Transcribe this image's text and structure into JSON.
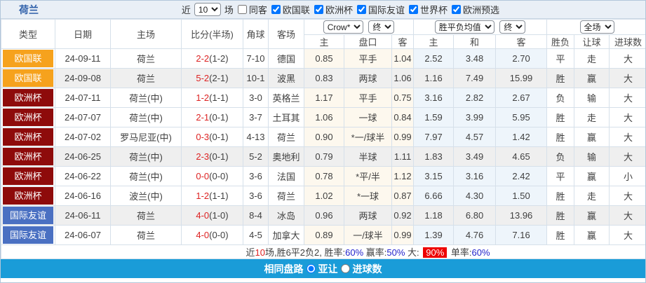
{
  "titlebar": {
    "title": "荷兰",
    "near_label": "近",
    "match_count": "10",
    "games_label": "场",
    "same_opponent": {
      "label": "同客",
      "checked": false
    },
    "leagues": [
      {
        "label": "欧国联",
        "checked": true
      },
      {
        "label": "欧洲杯",
        "checked": true
      },
      {
        "label": "国际友谊",
        "checked": true
      },
      {
        "label": "世界杯",
        "checked": true
      },
      {
        "label": "欧洲预选",
        "checked": true
      }
    ]
  },
  "controls": {
    "odds_source": "Crow*",
    "odds_time": "终",
    "avg_label": "胜平负均值",
    "avg_time": "终",
    "scope": "全场"
  },
  "table": {
    "header": {
      "main": [
        "类型",
        "日期",
        "主场",
        "比分(半场)",
        "角球",
        "客场"
      ],
      "sub": [
        "主",
        "盘口",
        "客",
        "主",
        "和",
        "客",
        "胜负",
        "让球",
        "进球数"
      ]
    },
    "rows": [
      {
        "league": {
          "label": "欧国联",
          "color": "orange"
        },
        "date": "24-09-11",
        "home": {
          "label": "荷兰",
          "green": true
        },
        "score_ft": "2-2",
        "score_ht": "(1-2)",
        "corners": "7-10",
        "away": {
          "label": "德国",
          "green": false
        },
        "crow": {
          "home": "0.85",
          "handicap": "平手",
          "handicap_color": "blue",
          "away": "1.04"
        },
        "avg": {
          "home": "2.52",
          "draw": "3.48",
          "away": "2.70"
        },
        "result": {
          "outcome": "平",
          "outcome_color": "blue",
          "handicap": "走",
          "handicap_color": "blue",
          "goals": "大",
          "goals_color": "red"
        },
        "shaded": false
      },
      {
        "league": {
          "label": "欧国联",
          "color": "orange"
        },
        "date": "24-09-08",
        "home": {
          "label": "荷兰",
          "green": true
        },
        "score_ft": "5-2",
        "score_ht": "(2-1)",
        "corners": "10-1",
        "away": {
          "label": "波黑",
          "green": false
        },
        "crow": {
          "home": "0.83",
          "handicap": "两球",
          "handicap_color": "blue",
          "away": "1.06"
        },
        "avg": {
          "home": "1.16",
          "draw": "7.49",
          "away": "15.99"
        },
        "result": {
          "outcome": "胜",
          "outcome_color": "red",
          "handicap": "赢",
          "handicap_color": "red",
          "goals": "大",
          "goals_color": "red"
        },
        "shaded": true
      },
      {
        "league": {
          "label": "欧洲杯",
          "color": "darkred"
        },
        "date": "24-07-11",
        "home": {
          "label": "荷兰(中)",
          "green": true
        },
        "score_ft": "1-2",
        "score_ht": "(1-1)",
        "corners": "3-0",
        "away": {
          "label": "英格兰",
          "green": false
        },
        "crow": {
          "home": "1.17",
          "handicap": "平手",
          "handicap_color": "blue",
          "away": "0.75"
        },
        "avg": {
          "home": "3.16",
          "draw": "2.82",
          "away": "2.67"
        },
        "result": {
          "outcome": "负",
          "outcome_color": "green",
          "handicap": "输",
          "handicap_color": "green",
          "goals": "大",
          "goals_color": "red"
        },
        "shaded": false
      },
      {
        "league": {
          "label": "欧洲杯",
          "color": "darkred"
        },
        "date": "24-07-07",
        "home": {
          "label": "荷兰(中)",
          "green": true
        },
        "score_ft": "2-1",
        "score_ht": "(0-1)",
        "corners": "3-7",
        "away": {
          "label": "土耳其",
          "green": false
        },
        "crow": {
          "home": "1.06",
          "handicap": "一球",
          "handicap_color": "blue",
          "away": "0.84"
        },
        "avg": {
          "home": "1.59",
          "draw": "3.99",
          "away": "5.95"
        },
        "result": {
          "outcome": "胜",
          "outcome_color": "red",
          "handicap": "走",
          "handicap_color": "blue",
          "goals": "大",
          "goals_color": "red"
        },
        "shaded": false
      },
      {
        "league": {
          "label": "欧洲杯",
          "color": "darkred"
        },
        "date": "24-07-02",
        "home": {
          "label": "罗马尼亚(中)",
          "green": false
        },
        "score_ft": "0-3",
        "score_ht": "(0-1)",
        "corners": "4-13",
        "away": {
          "label": "荷兰",
          "green": true
        },
        "crow": {
          "home": "0.90",
          "handicap": "*一/球半",
          "handicap_color": "red",
          "away": "0.99"
        },
        "avg": {
          "home": "7.97",
          "draw": "4.57",
          "away": "1.42"
        },
        "result": {
          "outcome": "胜",
          "outcome_color": "red",
          "handicap": "赢",
          "handicap_color": "red",
          "goals": "大",
          "goals_color": "red"
        },
        "shaded": false
      },
      {
        "league": {
          "label": "欧洲杯",
          "color": "darkred"
        },
        "date": "24-06-25",
        "home": {
          "label": "荷兰(中)",
          "green": true
        },
        "score_ft": "2-3",
        "score_ht": "(0-1)",
        "corners": "5-2",
        "away": {
          "label": "奥地利",
          "green": false
        },
        "crow": {
          "home": "0.79",
          "handicap": "半球",
          "handicap_color": "blue",
          "away": "1.11"
        },
        "avg": {
          "home": "1.83",
          "draw": "3.49",
          "away": "4.65"
        },
        "result": {
          "outcome": "负",
          "outcome_color": "green",
          "handicap": "输",
          "handicap_color": "green",
          "goals": "大",
          "goals_color": "red"
        },
        "shaded": true
      },
      {
        "league": {
          "label": "欧洲杯",
          "color": "darkred"
        },
        "date": "24-06-22",
        "home": {
          "label": "荷兰(中)",
          "green": true
        },
        "score_ft": "0-0",
        "score_ht": "(0-0)",
        "corners": "3-6",
        "away": {
          "label": "法国",
          "green": false
        },
        "crow": {
          "home": "0.78",
          "handicap": "*平/半",
          "handicap_color": "red",
          "away": "1.12"
        },
        "avg": {
          "home": "3.15",
          "draw": "3.16",
          "away": "2.42"
        },
        "result": {
          "outcome": "平",
          "outcome_color": "blue",
          "handicap": "赢",
          "handicap_color": "red",
          "goals": "小",
          "goals_color": "green"
        },
        "shaded": false
      },
      {
        "league": {
          "label": "欧洲杯",
          "color": "darkred"
        },
        "date": "24-06-16",
        "home": {
          "label": "波兰(中)",
          "green": false
        },
        "score_ft": "1-2",
        "score_ht": "(1-1)",
        "corners": "3-6",
        "away": {
          "label": "荷兰",
          "green": true
        },
        "crow": {
          "home": "1.02",
          "handicap": "*一球",
          "handicap_color": "red",
          "away": "0.87"
        },
        "avg": {
          "home": "6.66",
          "draw": "4.30",
          "away": "1.50"
        },
        "result": {
          "outcome": "胜",
          "outcome_color": "red",
          "handicap": "走",
          "handicap_color": "blue",
          "goals": "大",
          "goals_color": "red"
        },
        "shaded": false
      },
      {
        "league": {
          "label": "国际友谊",
          "color": "blue"
        },
        "date": "24-06-11",
        "home": {
          "label": "荷兰",
          "green": true
        },
        "score_ft": "4-0",
        "score_ht": "(1-0)",
        "corners": "8-4",
        "away": {
          "label": "冰岛",
          "green": false
        },
        "crow": {
          "home": "0.96",
          "handicap": "两球",
          "handicap_color": "blue",
          "away": "0.92"
        },
        "avg": {
          "home": "1.18",
          "draw": "6.80",
          "away": "13.96"
        },
        "result": {
          "outcome": "胜",
          "outcome_color": "red",
          "handicap": "赢",
          "handicap_color": "red",
          "goals": "大",
          "goals_color": "red"
        },
        "shaded": true
      },
      {
        "league": {
          "label": "国际友谊",
          "color": "blue"
        },
        "date": "24-06-07",
        "home": {
          "label": "荷兰",
          "green": true
        },
        "score_ft": "4-0",
        "score_ht": "(0-0)",
        "corners": "4-5",
        "away": {
          "label": "加拿大",
          "green": false
        },
        "crow": {
          "home": "0.89",
          "handicap": "一/球半",
          "handicap_color": "blue",
          "away": "0.99"
        },
        "avg": {
          "home": "1.39",
          "draw": "4.76",
          "away": "7.16"
        },
        "result": {
          "outcome": "胜",
          "outcome_color": "red",
          "handicap": "赢",
          "handicap_color": "red",
          "goals": "大",
          "goals_color": "red"
        },
        "shaded": false
      }
    ]
  },
  "summary": {
    "segments": [
      {
        "text": "近",
        "color": "dark"
      },
      {
        "text": "10",
        "color": "red"
      },
      {
        "text": "场,胜6平2负2, 胜率:",
        "color": "dark"
      },
      {
        "text": "60%",
        "color": "blue"
      },
      {
        "text": " 赢率:",
        "color": "dark"
      },
      {
        "text": "50%",
        "color": "blue"
      },
      {
        "text": " 大: ",
        "color": "dark"
      },
      {
        "text": "90%",
        "color": "badge-red"
      },
      {
        "text": " 单率:",
        "color": "dark"
      },
      {
        "text": "60%",
        "color": "blue"
      }
    ]
  },
  "footer": {
    "same_trend_label": "相同盘路",
    "options": [
      {
        "label": "亚让",
        "selected": true
      },
      {
        "label": "进球数",
        "selected": false
      }
    ]
  },
  "colors": {
    "league_orange": "#f6a21d",
    "league_darkred": "#8e0b0b",
    "league_blue": "#4a70c2",
    "team_green": "#1f9a1f",
    "score_red": "#dd2222",
    "handicap_blue": "#2323cb",
    "draw_odds_blue": "#4076a8",
    "big_badge_red": "#ee0000",
    "footer_blue": "#1a9cd8",
    "titlebar_bg": "#e9eff6"
  }
}
